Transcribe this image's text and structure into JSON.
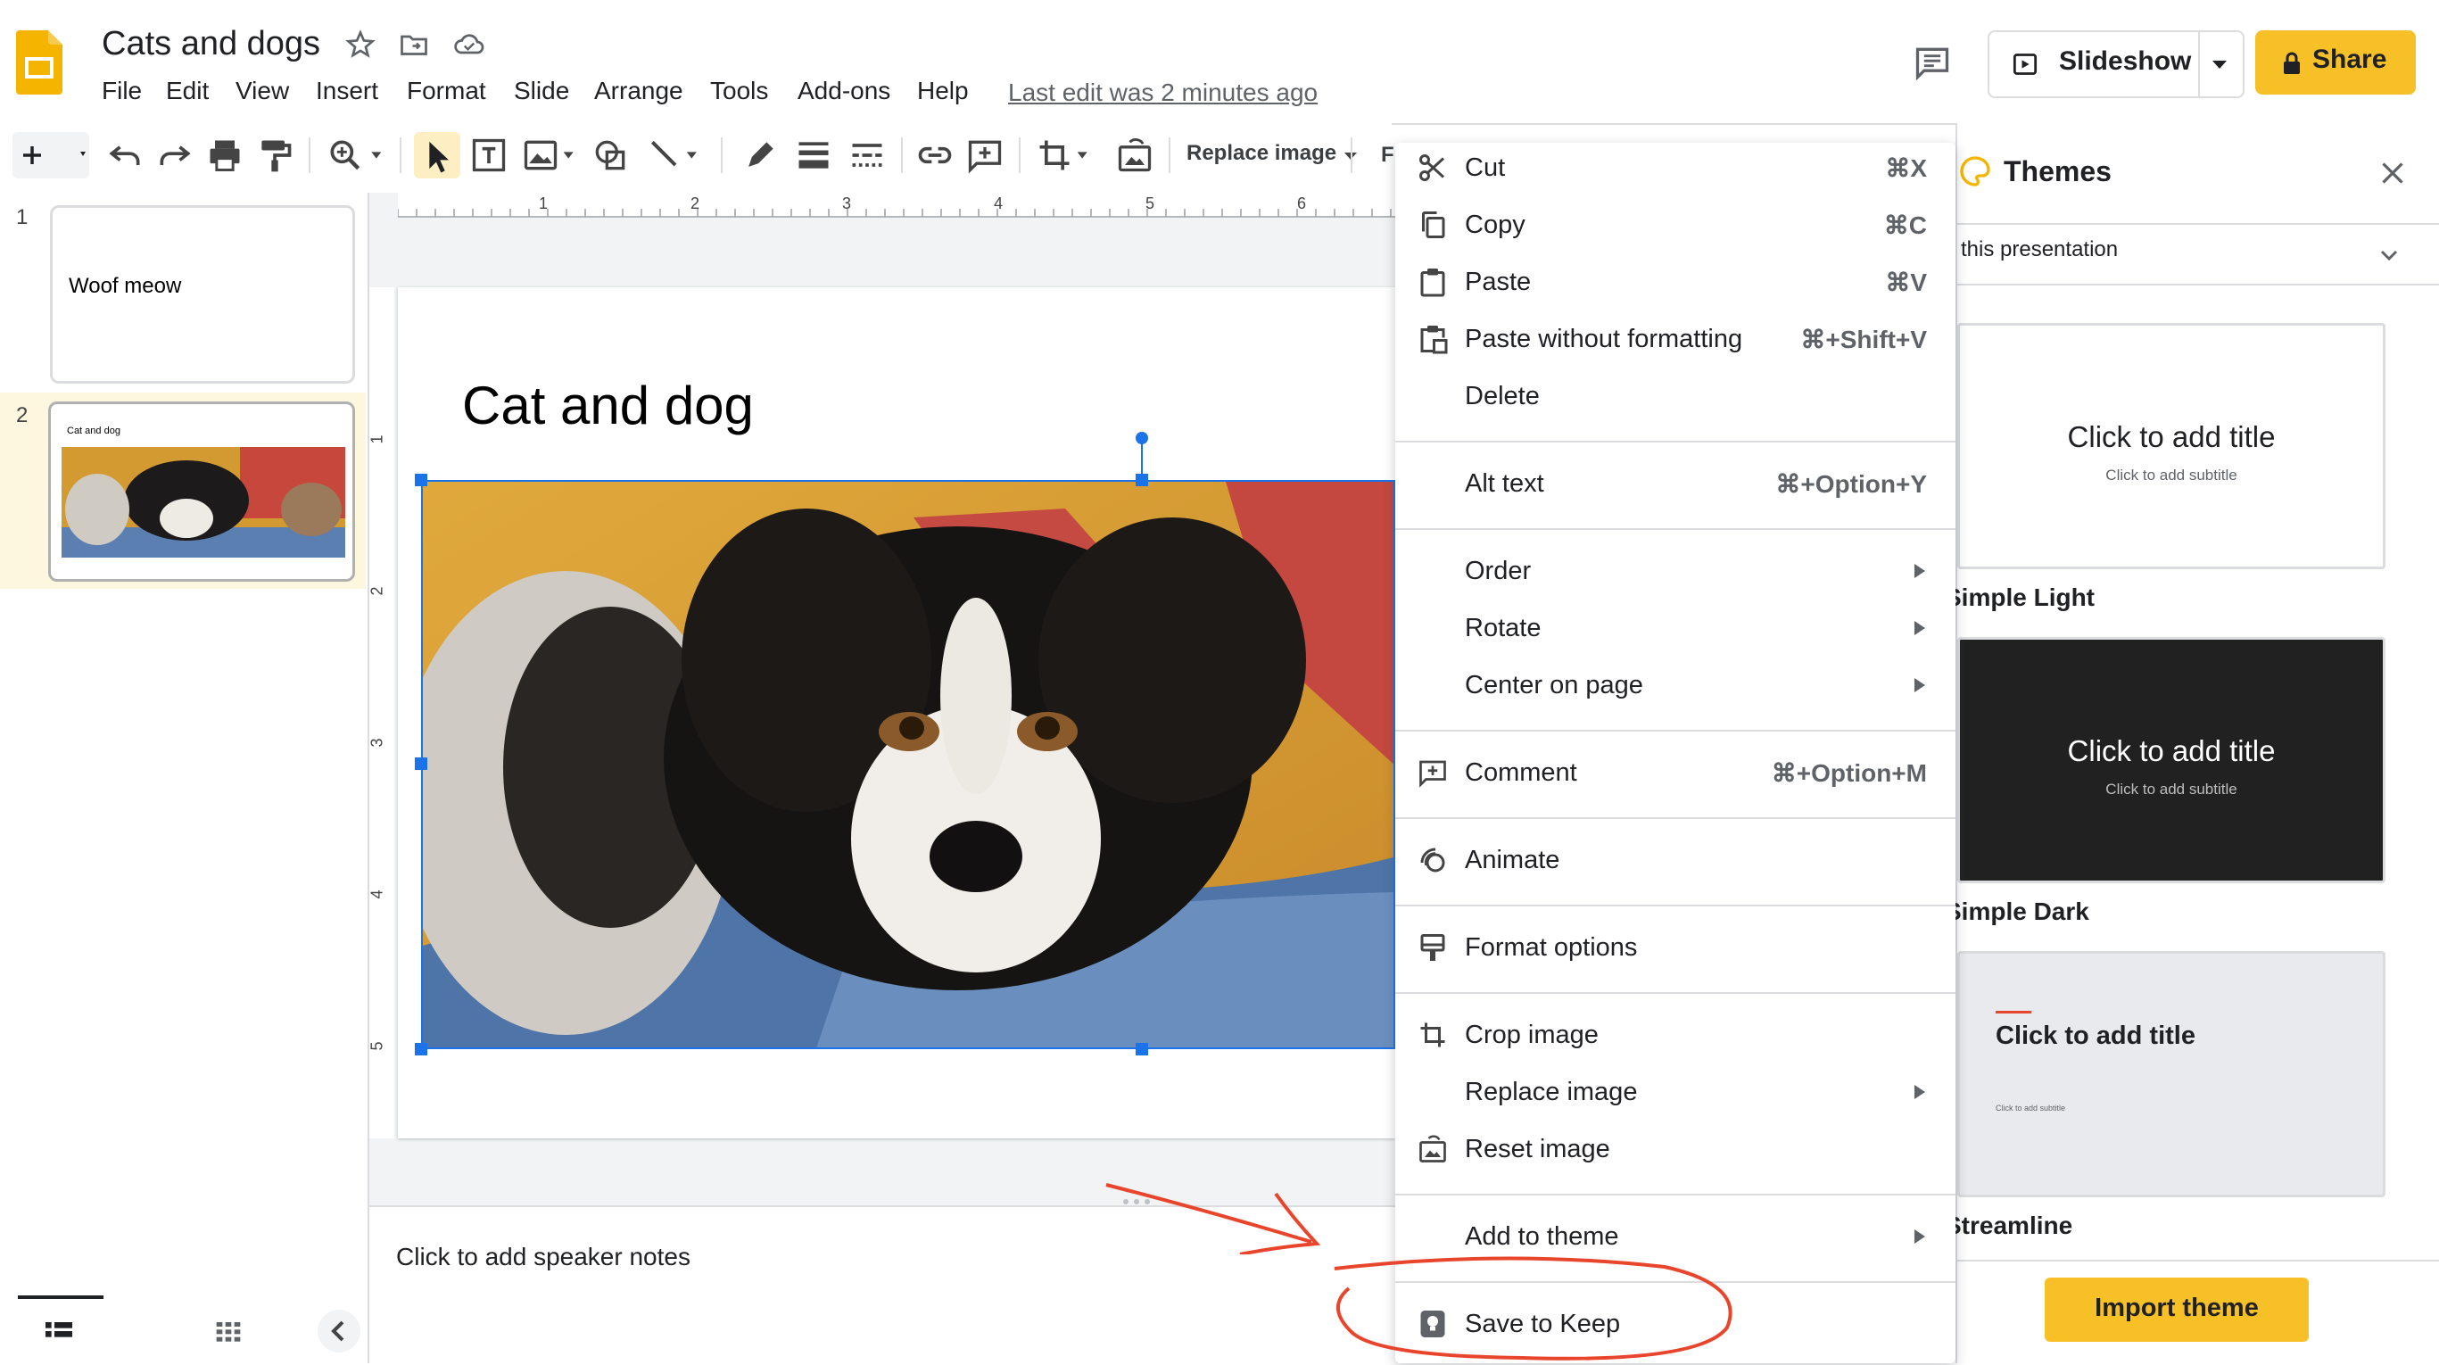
{
  "app": {
    "doc_title": "Cats and dogs",
    "menu": [
      "File",
      "Edit",
      "View",
      "Insert",
      "Format",
      "Slide",
      "Arrange",
      "Tools",
      "Add-ons",
      "Help"
    ],
    "last_edit": "Last edit was 2 minutes ago",
    "slideshow_label": "Slideshow",
    "share_label": "Share"
  },
  "toolbar": {
    "replace_image_label": "Replace image",
    "format_options_initial": "F"
  },
  "filmstrip": {
    "slides": [
      {
        "number": "1",
        "text": "Woof meow"
      },
      {
        "number": "2",
        "text": "Cat and dog"
      }
    ]
  },
  "slide": {
    "title": "Cat and dog"
  },
  "notes": {
    "placeholder": "Click to add speaker notes"
  },
  "ruler": {
    "h_ticks": [
      "1",
      "2",
      "3",
      "4",
      "5",
      "6"
    ],
    "v_ticks": [
      "1",
      "2",
      "3",
      "4",
      "5"
    ]
  },
  "context_menu": {
    "cut": {
      "label": "Cut",
      "shortcut": "⌘X"
    },
    "copy": {
      "label": "Copy",
      "shortcut": "⌘C"
    },
    "paste": {
      "label": "Paste",
      "shortcut": "⌘V"
    },
    "paste_plain": {
      "label": "Paste without formatting",
      "shortcut": "⌘+Shift+V"
    },
    "delete": {
      "label": "Delete"
    },
    "alt_text": {
      "label": "Alt text",
      "shortcut": "⌘+Option+Y"
    },
    "order": {
      "label": "Order"
    },
    "rotate": {
      "label": "Rotate"
    },
    "center": {
      "label": "Center on page"
    },
    "comment": {
      "label": "Comment",
      "shortcut": "⌘+Option+M"
    },
    "animate": {
      "label": "Animate"
    },
    "format_options": {
      "label": "Format options"
    },
    "crop": {
      "label": "Crop image"
    },
    "replace": {
      "label": "Replace image"
    },
    "reset": {
      "label": "Reset image"
    },
    "add_theme": {
      "label": "Add to theme"
    },
    "save_keep": {
      "label": "Save to Keep"
    }
  },
  "themes": {
    "title": "Themes",
    "filter_label": "this presentation",
    "cards": [
      {
        "name": "Simple Light",
        "title": "Click to add title",
        "subtitle": "Click to add subtitle"
      },
      {
        "name": "Simple Dark",
        "title": "Click to add title",
        "subtitle": "Click to add subtitle"
      },
      {
        "name": "Streamline",
        "title": "Click to add title",
        "subtitle": "Click to add subtitle"
      }
    ],
    "import_label": "Import theme"
  },
  "colors": {
    "accent_yellow": "#f6c026",
    "selection_blue": "#1a73e8",
    "annotation_red": "#e8452c"
  }
}
